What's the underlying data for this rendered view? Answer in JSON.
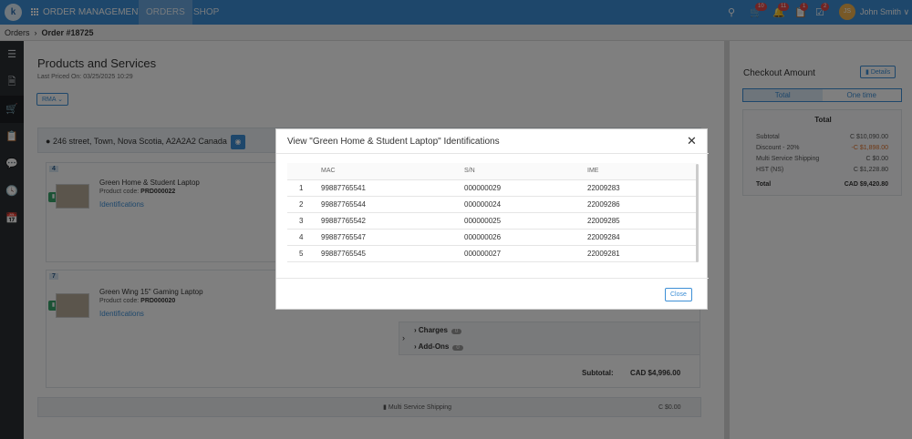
{
  "topbar": {
    "logo": "k",
    "app_title": "ORDER MANAGEMENT",
    "tabs": [
      {
        "label": "ORDERS"
      },
      {
        "label": "SHOP"
      }
    ],
    "badges": {
      "cart": "10",
      "bell": "11",
      "clipboard": "1",
      "tasks": "2"
    },
    "user": {
      "initials": "JS",
      "name": "John Smith ∨"
    }
  },
  "breadcrumb": {
    "root": "Orders",
    "current": "Order #18725"
  },
  "main": {
    "title": "Products and Services",
    "last_priced": "Last Priced On: 03/25/2025 10:29",
    "rma_label": "RMA ⌄",
    "address": "246 street, Town, Nova Scotia, A2A2A2 Canada",
    "products": [
      {
        "qty": "4",
        "name": "Green Home & Student Laptop",
        "code_label": "Product code:",
        "code": "PRD000022",
        "link": "Identifications"
      },
      {
        "qty": "7",
        "name": "Green Wing 15\" Gaming Laptop",
        "code_label": "Product code:",
        "code": "PRD000020",
        "link": "Identifications"
      }
    ],
    "extras": {
      "charges": "Charges",
      "charges_count": "0",
      "addons": "Add-Ons",
      "addons_count": "0"
    },
    "subtotal_label": "Subtotal:",
    "subtotal_value": "CAD $4,996.00",
    "shipping_label": "Multi Service Shipping",
    "shipping_value": "C $0.00"
  },
  "checkout": {
    "title": "Checkout Amount",
    "details_label": "Details",
    "tabs": [
      "Total",
      "One time"
    ],
    "total_heading": "Total",
    "rows": [
      {
        "label": "Subtotal",
        "value": "C $10,090.00"
      },
      {
        "label": "Discount - 20%",
        "value": "-C $1,898.00"
      },
      {
        "label": "Multi Service Shipping",
        "value": "C $0.00"
      },
      {
        "label": "HST (NS)",
        "value": "C $1,228.80"
      }
    ],
    "total_label": "Total",
    "total_value": "CAD $9,420.80"
  },
  "modal": {
    "title": "View \"Green Home & Student Laptop\" Identifications",
    "columns": [
      "",
      "MAC",
      "S/N",
      "IME"
    ],
    "rows": [
      [
        "1",
        "99887765541",
        "000000029",
        "22009283"
      ],
      [
        "2",
        "99887765544",
        "000000024",
        "22009286"
      ],
      [
        "3",
        "99887765542",
        "000000025",
        "22009285"
      ],
      [
        "4",
        "99887765547",
        "000000026",
        "22009284"
      ],
      [
        "5",
        "99887765545",
        "000000027",
        "22009281"
      ]
    ],
    "close_label": "Close"
  }
}
